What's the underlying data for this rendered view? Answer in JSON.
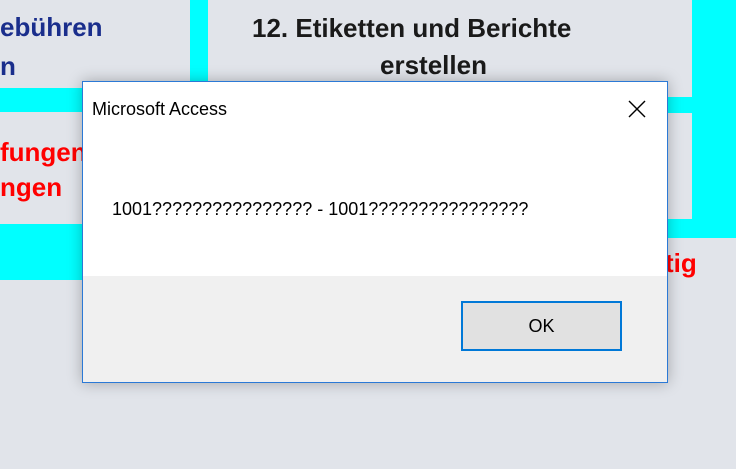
{
  "background": {
    "tile_left": {
      "line1": "ebühren",
      "line2": "n",
      "line3": "fungen",
      "line4": "ngen"
    },
    "tile_center": {
      "line1": "12. Etiketten und Berichte",
      "line2": "erstellen"
    },
    "tile_right": {
      "fragment": "tig"
    }
  },
  "dialog": {
    "title": "Microsoft Access",
    "message": "1001???????????????? -  1001????????????????",
    "ok_label": "OK"
  },
  "colors": {
    "cyan_tile": "#00ffff",
    "tile_face": "#e1e4ea",
    "blue_text": "#1a2e8c",
    "red_text": "#ff0000",
    "accent": "#0078d7"
  }
}
